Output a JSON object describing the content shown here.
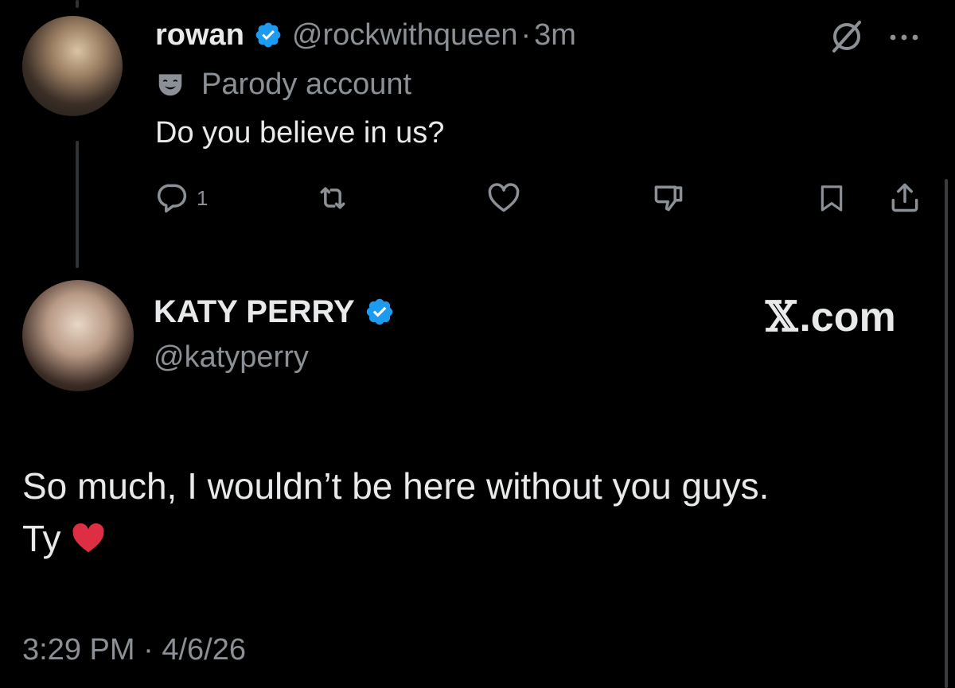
{
  "reply_tweet": {
    "display_name": "rowan",
    "handle": "@rockwithqueen",
    "separator": "·",
    "timestamp": "3m",
    "parody_label": "Parody account",
    "text": "Do you believe in us?",
    "actions": {
      "reply_count": "1"
    }
  },
  "main_tweet": {
    "display_name": "KATY PERRY",
    "handle": "@katyperry",
    "brand_x": "𝕏",
    "brand_suffix": ".com",
    "text_line1": "So much, I wouldn’t be here without you guys.",
    "text_line2": "Ty",
    "timestamp": "3:29 PM",
    "separator": "·",
    "date": "4/6/26"
  },
  "colors": {
    "background": "#000000",
    "verified_blue": "#1d9bf0",
    "secondary_text": "#8b9096",
    "primary_text": "#e7e9ea",
    "heart_emoji": "#dd2e44"
  },
  "icons": {
    "verified": "verified-badge-icon",
    "parody": "parody-mask-icon",
    "grok": "grok-icon",
    "more": "more-icon",
    "reply": "reply-icon",
    "retweet": "retweet-icon",
    "like": "heart-icon",
    "dislike": "thumbs-down-icon",
    "bookmark": "bookmark-icon",
    "share": "share-icon",
    "emoji": "red-heart-emoji-icon"
  }
}
